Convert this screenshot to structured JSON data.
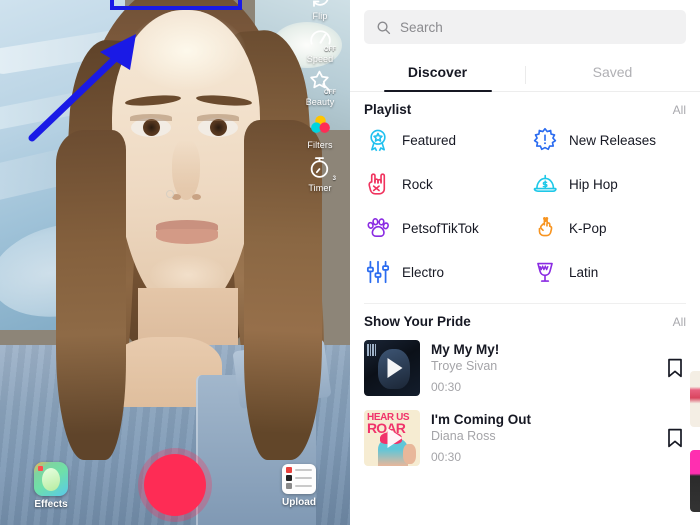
{
  "camera": {
    "tools": [
      {
        "label": "Flip",
        "icon": "flip-camera-icon",
        "badge": ""
      },
      {
        "label": "Speed",
        "icon": "speed-icon",
        "badge": "OFF"
      },
      {
        "label": "Beauty",
        "icon": "beauty-wand-icon",
        "badge": "OFF"
      },
      {
        "label": "Filters",
        "icon": "filters-icon",
        "badge": ""
      },
      {
        "label": "Timer",
        "icon": "timer-icon",
        "badge": "3"
      }
    ],
    "bottom": {
      "effects_label": "Effects",
      "effects_icon": "effects-icon",
      "upload_label": "Upload",
      "upload_icon": "upload-icon",
      "record_icon": "record-button-icon"
    },
    "annotation": {
      "rect_color": "#1a1ae6",
      "arrow_color": "#1a1ae6"
    }
  },
  "music": {
    "search": {
      "placeholder": "Search",
      "icon": "search-icon"
    },
    "tabs": [
      {
        "label": "Discover",
        "active": true
      },
      {
        "label": "Saved",
        "active": false
      }
    ],
    "playlist_section": {
      "title": "Playlist",
      "all_label": "All",
      "items": [
        {
          "label": "Featured",
          "icon": "award-badge-icon",
          "color": "#20c0ef"
        },
        {
          "label": "New Releases",
          "icon": "burst-alert-icon",
          "color": "#2b6cf0"
        },
        {
          "label": "Rock",
          "icon": "rock-hand-icon",
          "color": "#f0335e"
        },
        {
          "label": "Hip Hop",
          "icon": "cap-dollar-icon",
          "color": "#1ec8e8"
        },
        {
          "label": "PetsofTikTok",
          "icon": "paw-print-icon",
          "color": "#8a2be2"
        },
        {
          "label": "K-Pop",
          "icon": "finger-heart-icon",
          "color": "#f79420"
        },
        {
          "label": "Electro",
          "icon": "equalizer-icon",
          "color": "#2b6cf0"
        },
        {
          "label": "Latin",
          "icon": "conga-drum-icon",
          "color": "#8a2be2"
        }
      ]
    },
    "pride_section": {
      "title": "Show Your Pride",
      "all_label": "All",
      "songs": [
        {
          "title": "My My My!",
          "artist": "Troye Sivan",
          "duration": "00:30",
          "cover": "troye-sivan-cover",
          "bookmark_icon": "bookmark-icon"
        },
        {
          "title": "I'm Coming Out",
          "artist": "Diana Ross",
          "duration": "00:30",
          "cover_text_line1": "HEAR US",
          "cover_text_line2": "ROAR",
          "cover": "hear-us-roar-cover",
          "bookmark_icon": "bookmark-icon"
        }
      ]
    }
  }
}
